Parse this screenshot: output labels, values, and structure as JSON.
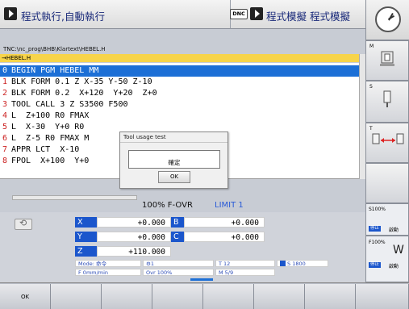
{
  "header": {
    "left_title": "程式執行,自動執行",
    "dnc_label": "DNC",
    "right_title": "程式模擬 程式模擬"
  },
  "program": {
    "path": "TNC:\\nc_prog\\BHB\\Klartext\\HEBEL.H",
    "file": "→HEBEL.H",
    "lines": [
      {
        "n": "0",
        "text": "BEGIN PGM HEBEL MM",
        "selected": true
      },
      {
        "n": "1",
        "text": "BLK FORM 0.1 Z X-35 Y-50 Z-10"
      },
      {
        "n": "2",
        "text": "BLK FORM 0.2  X+120  Y+20  Z+0"
      },
      {
        "n": "3",
        "text": "TOOL CALL 3 Z S3500 F500"
      },
      {
        "n": "4",
        "text": "L  Z+100 R0 FMAX"
      },
      {
        "n": "5",
        "text": "L  X-30  Y+0 R0"
      },
      {
        "n": "6",
        "text": "L  Z-5 R0 FMAX M"
      },
      {
        "n": "7",
        "text": "APPR LCT  X-10"
      },
      {
        "n": "8",
        "text": "FPOL  X+100  Y+0"
      }
    ]
  },
  "dialog": {
    "title": "Tool usage test",
    "message": "確定",
    "ok_label": "OK"
  },
  "override": {
    "value": "100% F-OVR",
    "limit": "LIMIT 1"
  },
  "axes": [
    {
      "label": "X",
      "value": "+0.000"
    },
    {
      "label": "B",
      "value": "+0.000"
    },
    {
      "label": "Y",
      "value": "+0.000"
    },
    {
      "label": "C",
      "value": "+0.000"
    },
    {
      "label": "Z",
      "value": "+110.000"
    }
  ],
  "status": {
    "mode": "Mode: 命令",
    "tool_no": "1",
    "t": "T 12",
    "s": "S 1800",
    "feed": "F 0mm/min",
    "ovr": "Ovr 100%",
    "m": "M 5/9"
  },
  "side": {
    "m_label": "M",
    "s_label": "S",
    "t_label": "T",
    "s_ovr": "S100%",
    "s_state1": "停止",
    "s_state2": "啟動",
    "f_ovr": "F100%",
    "f_state1": "停止",
    "f_state2": "啟動"
  },
  "softkeys": [
    "OK",
    "",
    "",
    "",
    "",
    "",
    "",
    ""
  ]
}
